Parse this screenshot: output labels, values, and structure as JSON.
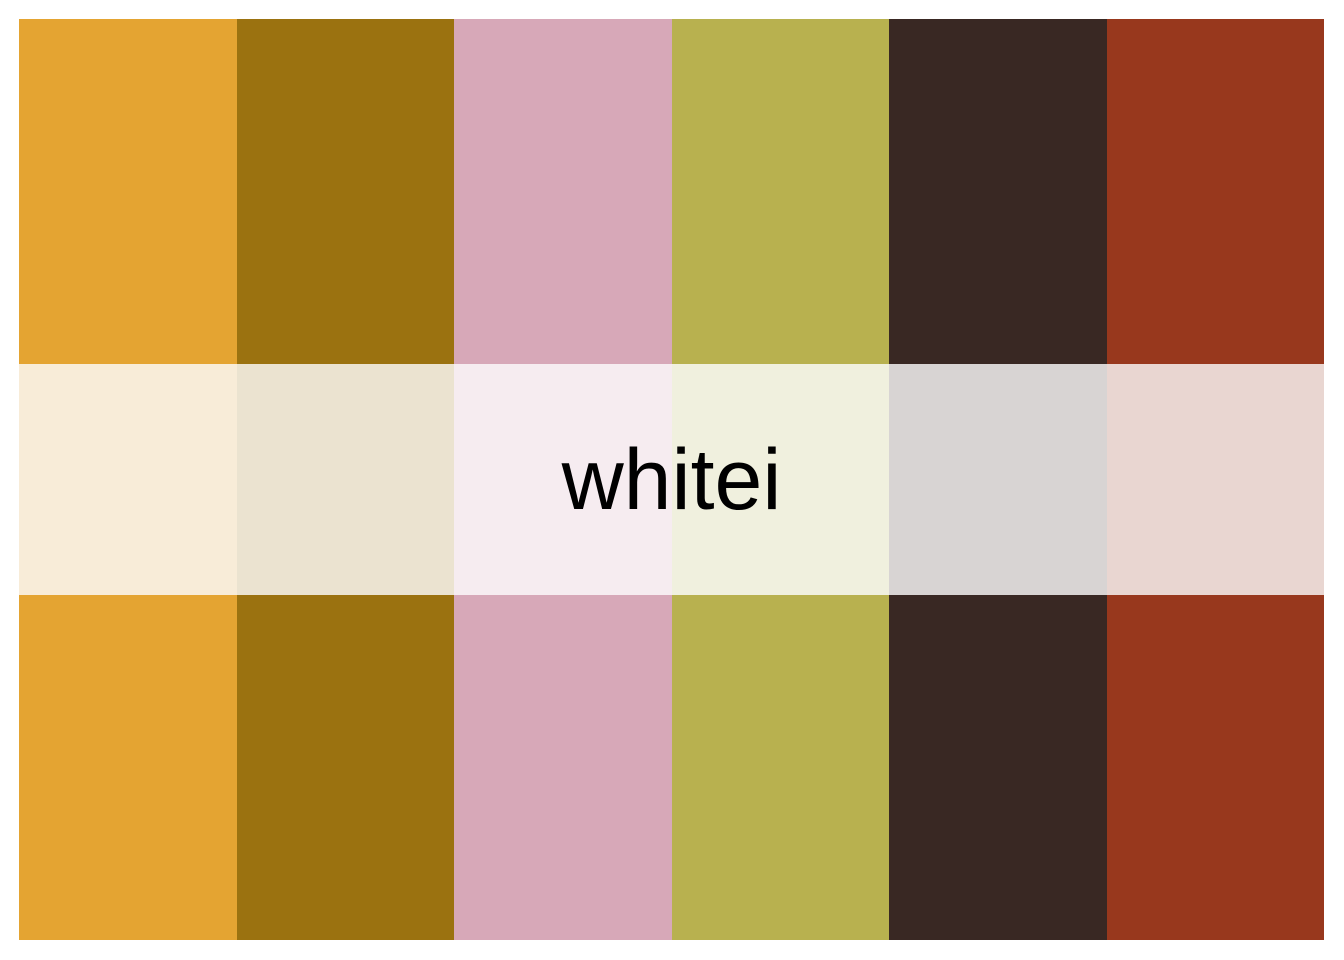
{
  "label": "whitei",
  "colors": [
    "#e4a432",
    "#9b7210",
    "#d7a8b8",
    "#b8b14f",
    "#392823",
    "#98381d"
  ],
  "tints": [
    "#f8ecd8",
    "#ebe3d0",
    "#f6ecf0",
    "#f0f0de",
    "#d8d4d3",
    "#e9d6d1"
  ]
}
